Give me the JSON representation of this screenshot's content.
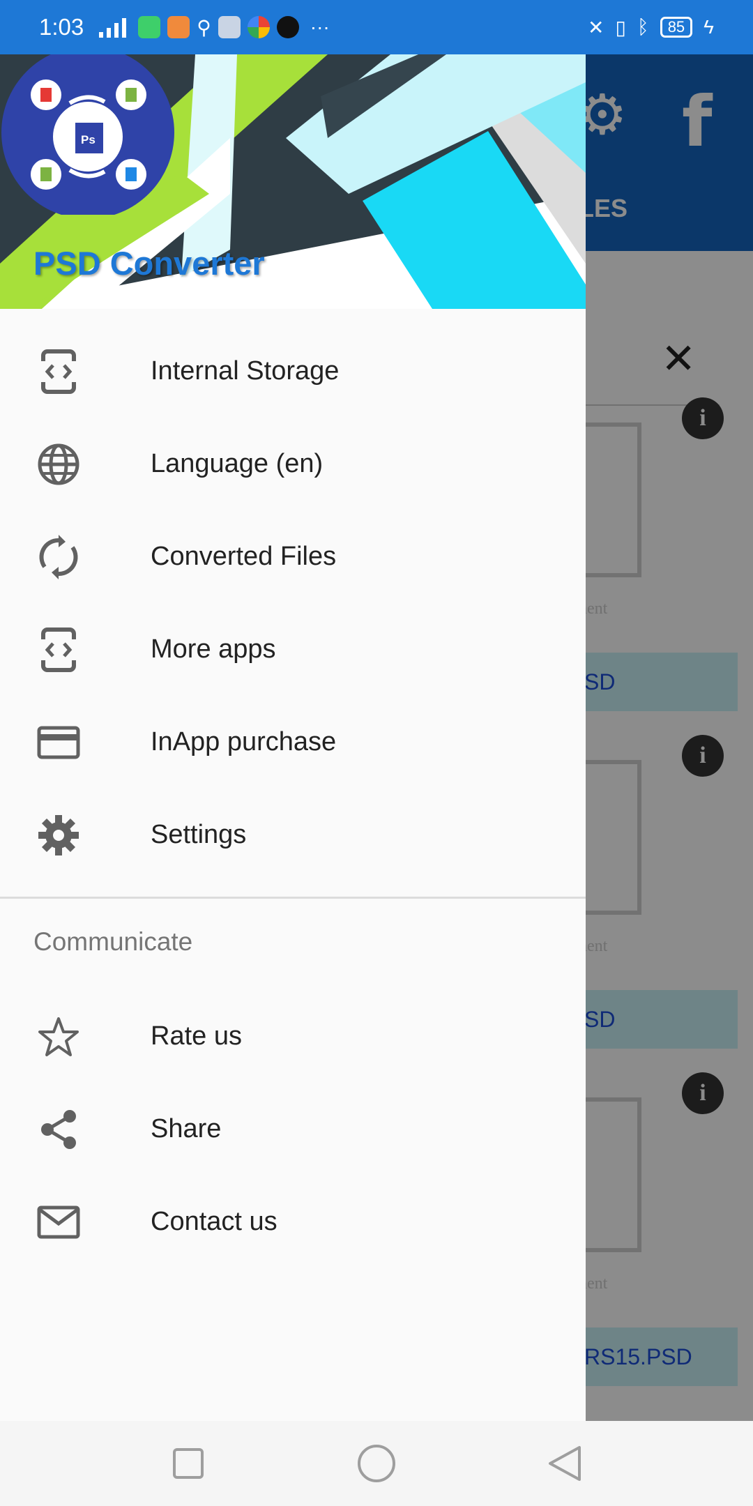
{
  "status_bar": {
    "time": "1:03",
    "battery": "85",
    "more": "···"
  },
  "background": {
    "tab_fragment": "LES",
    "file_fragment_1": "SD",
    "file_fragment_2": "SD",
    "file_fragment_3": "RS15.PSD",
    "doc_text_fragment": "nent"
  },
  "drawer": {
    "app_title": "PSD Converter",
    "menu": [
      {
        "label": "Internal Storage",
        "icon": "code-brackets-icon"
      },
      {
        "label": "Language (en)",
        "icon": "globe-icon"
      },
      {
        "label": "Converted Files",
        "icon": "sync-icon"
      },
      {
        "label": "More apps",
        "icon": "code-brackets-icon"
      },
      {
        "label": "InApp purchase",
        "icon": "credit-card-icon"
      },
      {
        "label": "Settings",
        "icon": "gear-icon"
      }
    ],
    "section_title": "Communicate",
    "communicate": [
      {
        "label": "Rate us",
        "icon": "star-icon"
      },
      {
        "label": "Share",
        "icon": "share-icon"
      },
      {
        "label": "Contact us",
        "icon": "mail-icon"
      }
    ]
  },
  "colors": {
    "status_bar": "#1e78d6",
    "accent": "#1e78d6",
    "icon": "#616161"
  }
}
